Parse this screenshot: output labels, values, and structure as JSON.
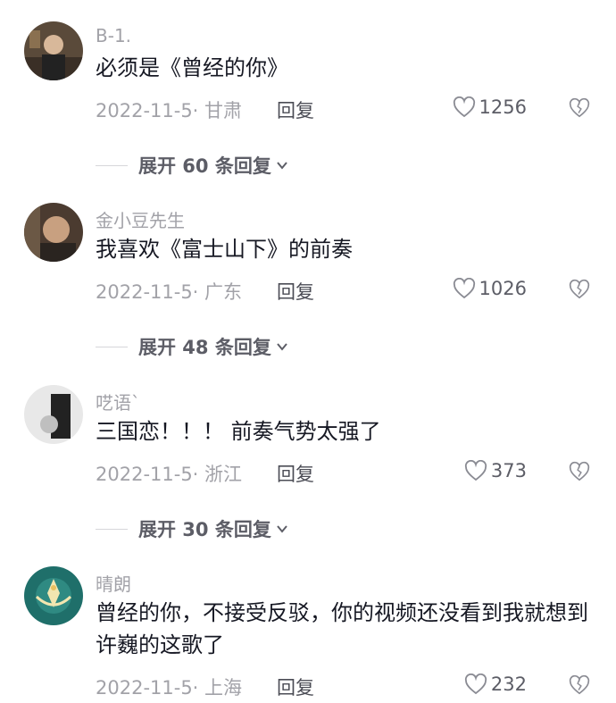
{
  "comments": [
    {
      "username": "B-1.",
      "text": "必须是《曾经的你》",
      "meta": "2022-11-5· 甘肃",
      "reply_label": "回复",
      "likes": "1256",
      "expand": "展开 60 条回复"
    },
    {
      "username": "金小豆先生",
      "text": "我喜欢《富士山下》的前奏",
      "meta": "2022-11-5· 广东",
      "reply_label": "回复",
      "likes": "1026",
      "expand": "展开 48 条回复"
    },
    {
      "username": "呓语`",
      "text": "三国恋！！！ 前奏气势太强了",
      "meta": "2022-11-5· 浙江",
      "reply_label": "回复",
      "likes": "373",
      "expand": "展开 30 条回复"
    },
    {
      "username": "晴朗",
      "text": "曾经的你，不接受反驳，你的视频还没看到我就想到许巍的这歌了",
      "meta": "2022-11-5· 上海",
      "reply_label": "回复",
      "likes": "232"
    }
  ],
  "icons": {
    "like": "heart-outline-icon",
    "dislike": "broken-heart-icon",
    "expand": "chevron-down-icon"
  },
  "colors": {
    "text": "#161823",
    "muted": "#a2a2a8",
    "secondary": "#5c5d66"
  }
}
